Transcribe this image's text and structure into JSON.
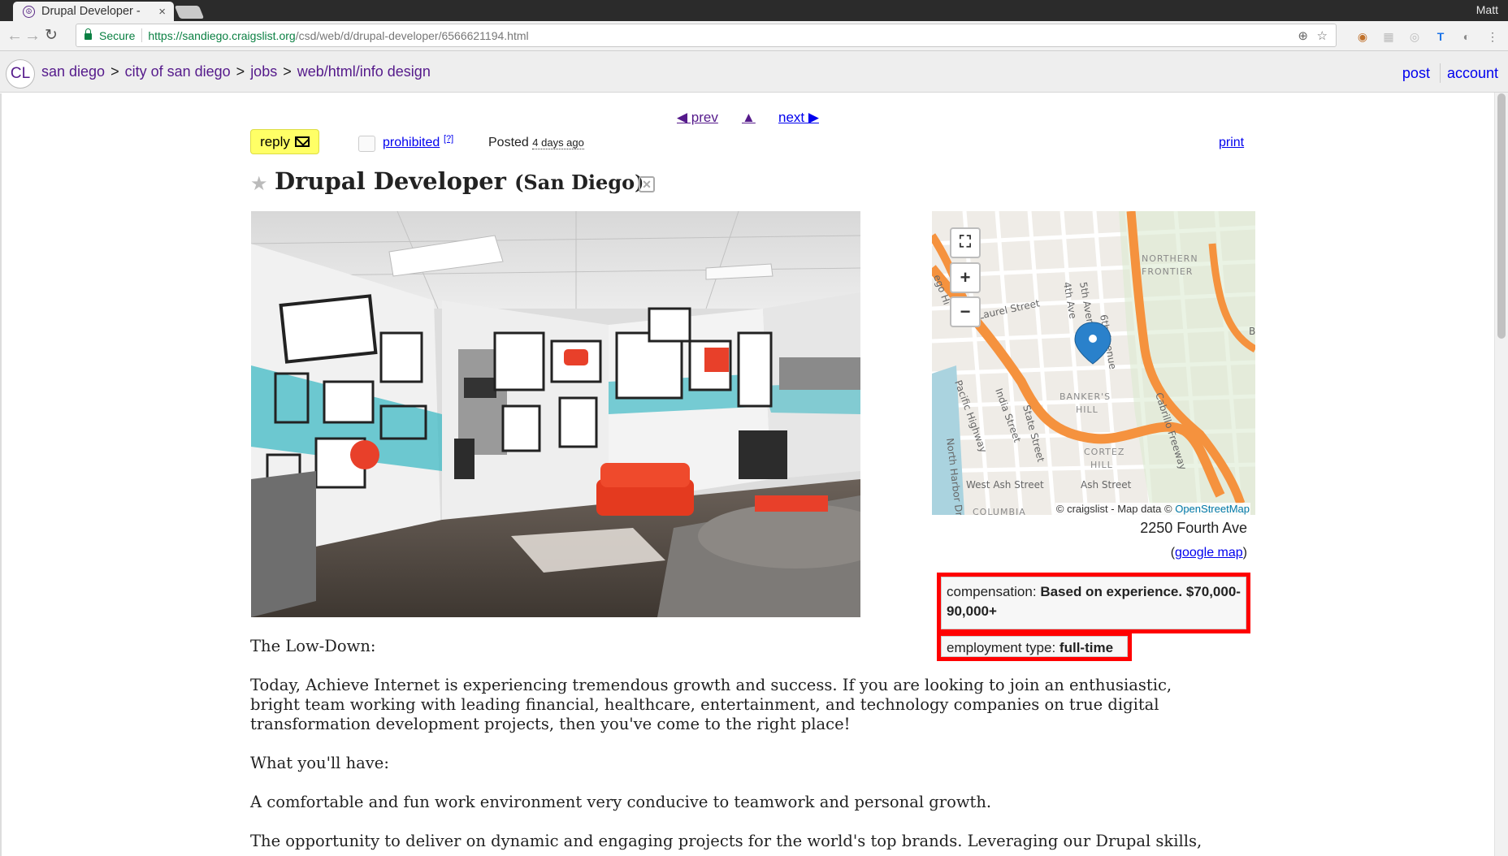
{
  "browser": {
    "tab_title": "Drupal Developer -",
    "tab_close": "×",
    "user": "Matt",
    "secure_label": "Secure",
    "url_host": "https://sandiego.craigslist.org",
    "url_path": "/csd/web/d/drupal-developer/6566621194.html"
  },
  "header": {
    "logo": "CL",
    "breadcrumbs": [
      "san diego",
      "city of san diego",
      "jobs",
      "web/html/info design"
    ],
    "breadcrumb_separator": ">",
    "post_label": "post",
    "account_label": "account"
  },
  "pager": {
    "prev_label": "◀ prev",
    "up_label": "▲",
    "next_label": "next ▶"
  },
  "actions": {
    "reply_label": "reply",
    "prohibited_label": "prohibited",
    "help_label": "[?]",
    "posted_label": "Posted",
    "posted_ago": "4 days ago",
    "print_label": "print"
  },
  "posting": {
    "title": "Drupal Developer",
    "location": "(San Diego)",
    "address": "2250 Fourth Ave",
    "google_map_label": "google map",
    "compensation_label": "compensation:",
    "compensation_value": "Based on experience. $70,000-90,000+",
    "employment_label": "employment type:",
    "employment_value": "full-time",
    "body": [
      "The Low-Down:",
      "Today, Achieve Internet is experiencing tremendous growth and success. If you are looking to join an enthusiastic,",
      "bright team working with leading financial, healthcare, entertainment, and technology companies on true digital",
      "transformation development projects, then you've come to the right place!",
      "What you'll have:",
      "A comfortable and fun work environment very conducive to teamwork and personal growth.",
      "The opportunity to deliver on dynamic and engaging projects for the world's top brands. Leveraging our Drupal skills,"
    ]
  },
  "map": {
    "attribution": "© craigslist - Map data ©",
    "attribution_link": "OpenStreetMap",
    "labels": [
      "West Laurel Street",
      "4th Ave",
      "5th Avenue",
      "6th Avenue",
      "NORTHERN",
      "FRONTIER",
      "Pacific Highway",
      "India Street",
      "State Street",
      "BANKER'S",
      "HILL",
      "Cabrillo Freeway",
      "CORTEZ",
      "HILL",
      "North Harbor Dr",
      "West Ash Street",
      "Ash Street",
      "COLUMBIA",
      "ego Hi",
      "B"
    ],
    "zoom_in": "+",
    "zoom_out": "−",
    "fullscreen": "⛶"
  },
  "colors": {
    "link": "#0000ee",
    "visited": "#551a8b",
    "reply_bg": "#ffff66",
    "highlight": "#ff0000",
    "freeway": "#f5923e",
    "marker": "#2a81cb"
  }
}
